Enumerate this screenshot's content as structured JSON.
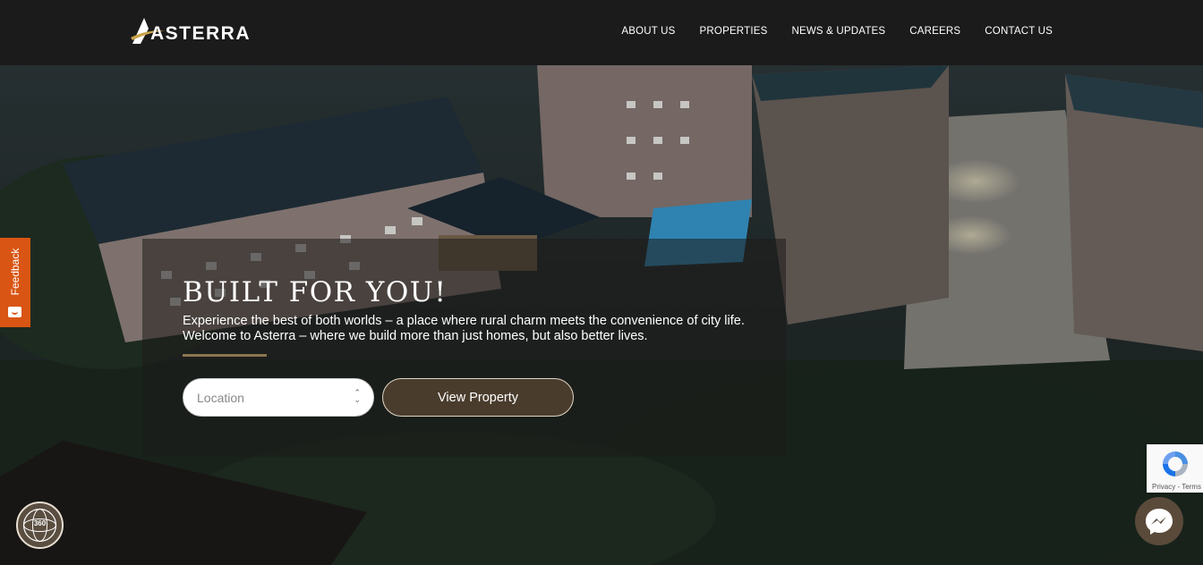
{
  "brand": {
    "name": "ASTERRA",
    "accent_color": "#c9a34a"
  },
  "nav": {
    "items": [
      {
        "label": "ABOUT US"
      },
      {
        "label": "PROPERTIES"
      },
      {
        "label": "NEWS & UPDATES"
      },
      {
        "label": "CAREERS"
      },
      {
        "label": "CONTACT US"
      }
    ]
  },
  "hero": {
    "title": "BUILT FOR YOU!",
    "description_line1": "Experience the best of both worlds – a place where rural charm meets the convenience of city life.",
    "description_line2": "Welcome to Asterra – where we build more than just homes, but also better lives.",
    "location_placeholder": "Location",
    "view_button_label": "View Property"
  },
  "widgets": {
    "feedback_label": "Feedback",
    "tour_label": "360",
    "recaptcha_links": "Privacy - Terms",
    "messenger_icon": "messenger-icon"
  },
  "colors": {
    "header_bg": "#1b1b1b",
    "button_bg": "#4a3c2c",
    "feedback_bg": "#d95514",
    "accent_line": "#8b7550"
  }
}
